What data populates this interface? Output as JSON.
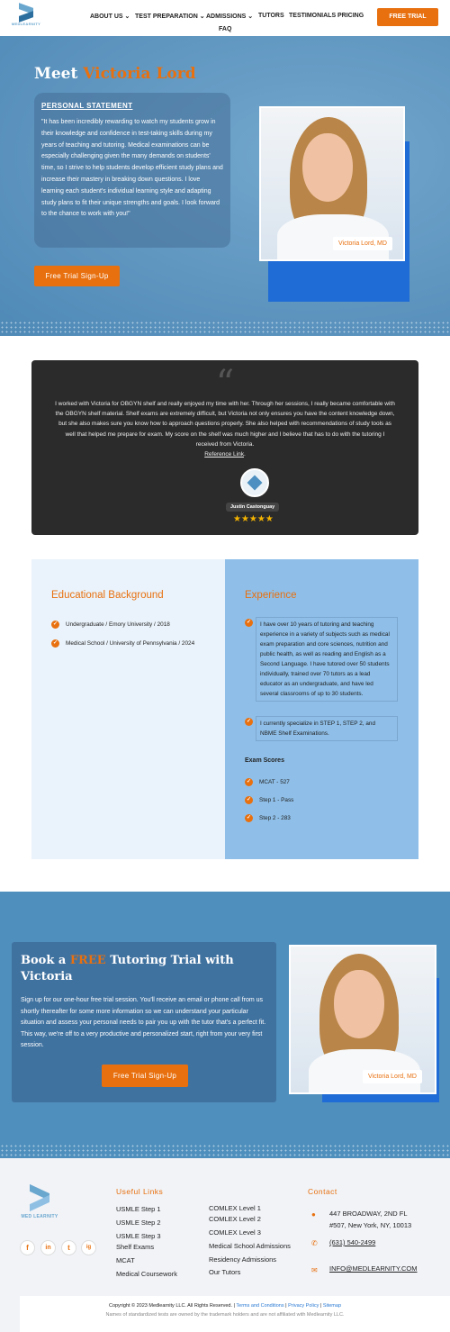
{
  "header": {
    "logo_text": "MEDLEARNITY",
    "nav": [
      "ABOUT US",
      "TEST PREPARATION",
      "ADMISSIONS",
      "TUTORS",
      "TESTIMONIALS",
      "PRICING",
      "FAQ"
    ],
    "cta": "FREE TRIAL"
  },
  "hero": {
    "title_prefix": "Meet ",
    "title_name": "Victoria Lord",
    "statement_heading": "PERSONAL STATEMENT",
    "statement_text": "\"It has been incredibly rewarding to watch my students grow in their knowledge and confidence in test-taking skills during my years of teaching and tutoring. Medical examinations can be especially challenging given the many demands on students' time, so I strive to help students develop efficient study plans and increase their mastery in breaking down questions. I love learning each student's individual learning style and adapting study plans to fit their unique strengths and goals. I look forward to the chance to work with you!\"",
    "button": "Free Trial Sign-Up",
    "photo_caption": "Victoria Lord, MD"
  },
  "testimonial": {
    "text": "I worked with Victoria for OBGYN shelf and really enjoyed my time with her. Through her sessions, I really became comfortable with the OBGYN shelf material. Shelf exams are extremely difficult, but Victoria not only ensures you have the content knowledge down, but she also makes sure you know how to approach questions properly. She also helped with recommendations of study tools as well that helped me prepare for exam. My score on the shelf was much higher and I believe that has to do with the tutoring I received from Victoria.",
    "link": "Reference Link",
    "author": "Justin Castonguay",
    "stars": "★★★★★"
  },
  "education": {
    "heading": "Educational Background",
    "items": [
      "Undergraduate / Emory University / 2018",
      "Medical School / University of Pennsylvania / 2024"
    ]
  },
  "experience": {
    "heading": "Experience",
    "items": [
      "I have over 10 years of tutoring and teaching experience in a variety of subjects such as medical exam preparation and core sciences, nutrition and public health, as well as reading and English as a Second Language. I have tutored over 50 students individually, trained over 70 tutors as a lead educator as an undergraduate, and have led several classrooms of up to 30 students.",
      "I currently specialize in STEP 1, STEP 2, and NBME Shelf Examinations."
    ],
    "scores_heading": "Exam Scores",
    "scores": [
      "MCAT - 527",
      "Step 1 - Pass",
      "Step 2 - 283"
    ]
  },
  "cta": {
    "title_a": "Book a ",
    "title_free": "FREE",
    "title_b": " Tutoring Trial with Victoria",
    "text": "Sign up for our one-hour free trial session. You'll receive an email or phone call from us shortly thereafter for some more information so we can understand your particular situation and assess your personal needs to pair you up with the tutor that's a perfect fit. This way, we're off to a very productive and personalized start, right from your very first session.",
    "button": "Free Trial Sign-Up",
    "photo_caption": "Victoria Lord, MD"
  },
  "footer": {
    "logo_text": "MED LEARNITY",
    "social": [
      "f",
      "in",
      "t",
      "ig"
    ],
    "useful_heading": "Useful Links",
    "links_col1": [
      "USMLE Step 1",
      "USMLE Step 2",
      "USMLE Step 3",
      "Shelf Exams",
      "MCAT",
      "Medical Coursework"
    ],
    "links_col2": [
      "COMLEX Level 1",
      "COMLEX Level 2",
      "COMLEX Level 3",
      "Medical School Admissions",
      "Residency Admissions",
      "Our Tutors"
    ],
    "contact_heading": "Contact",
    "address1": "447 BROADWAY, 2ND FL",
    "address2": "#507, New York, NY, 10013",
    "phone": "(631) 540-2499",
    "email": "INFO@MEDLEARNITY.COM",
    "copyright": "Copyright © 2023 Medlearnity LLC. All Rights Reserved. | ",
    "terms": "Terms and Conditions",
    "privacy": "Privacy Policy",
    "sitemap": "Sitemap",
    "disclaimer": "Names of standardized tests are owned by the trademark holders and are not affiliated with Medlearnity LLC."
  },
  "colors": {
    "accent": "#e8700f",
    "hero_blue": "#5b98c4",
    "exp_blue": "#8fbfe8"
  }
}
